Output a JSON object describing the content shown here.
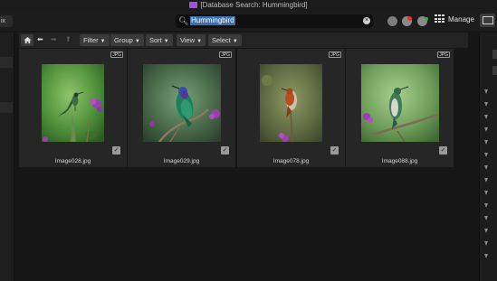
{
  "window": {
    "title": "[Database Search: Hummingbird]"
  },
  "left_tab": {
    "label": "ix"
  },
  "search": {
    "query": "Hummingbird"
  },
  "header": {
    "manage_label": "Manage"
  },
  "toolbar": {
    "filter_label": "Filter",
    "group_label": "Group",
    "sort_label": "Sort",
    "view_label": "View",
    "select_label": "Select"
  },
  "images": [
    {
      "filename": "Image028.jpg",
      "badge": "JPG",
      "checked": true
    },
    {
      "filename": "Image029.jpg",
      "badge": "JPG",
      "checked": true
    },
    {
      "filename": "Image078.jpg",
      "badge": "JPG",
      "checked": true
    },
    {
      "filename": "Image088.jpg",
      "badge": "JPG",
      "checked": true
    }
  ],
  "colors": {
    "background": "#161616",
    "thumbnail_bg": "#262626",
    "accent_selection": "#3a6fb0",
    "folder_icon": "#9b59d0"
  },
  "icons": {
    "search": "magnifier-icon",
    "clear": "clear-search-icon",
    "home": "home-icon",
    "back": "back-arrow-icon",
    "forward": "forward-arrow-icon",
    "up": "up-arrow-icon",
    "manage": "grid-icon"
  }
}
